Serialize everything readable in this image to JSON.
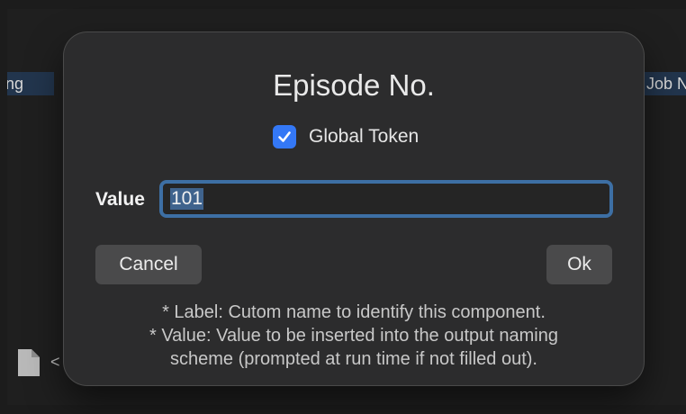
{
  "background": {
    "left_tag": "ng",
    "right_tag": "Job N",
    "file_text": "<"
  },
  "dialog": {
    "title": "Episode No.",
    "global_token": {
      "label": "Global Token",
      "checked": true
    },
    "value_label": "Value",
    "value_input": "101",
    "cancel_label": "Cancel",
    "ok_label": "Ok",
    "help_lines": [
      "* Label: Cutom name to identify this component.",
      "* Value: Value to be inserted into the output naming",
      "scheme (prompted at run time if not filled out)."
    ]
  },
  "colors": {
    "accent": "#3478f6",
    "focus_ring": "#3d6fa4",
    "selection": "#3f638d",
    "dialog_bg": "#2c2c2d"
  },
  "icons": {
    "checkbox": "checkmark-icon",
    "file": "document-icon"
  }
}
